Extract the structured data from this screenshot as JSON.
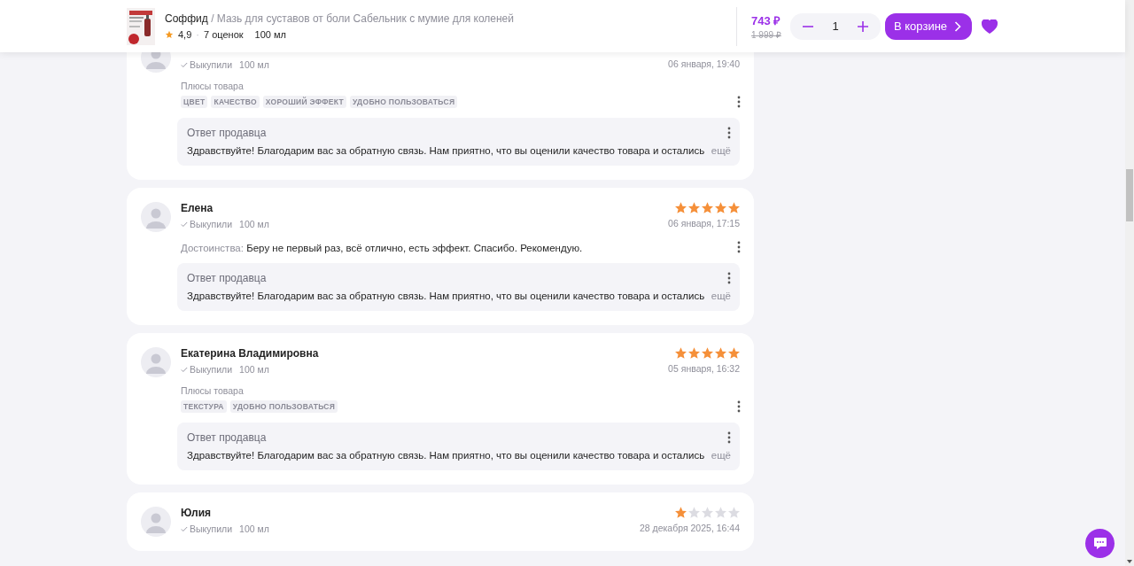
{
  "header": {
    "brand": "Соффид",
    "title": "/ Мазь для суставов от боли Сабельник с мумие для коленей",
    "rating": "4,9",
    "separator": "·",
    "reviews_count": "7 оценок",
    "volume": "100 мл",
    "price": "743 ₽",
    "old_price": "1 999 ₽",
    "quantity": "1",
    "cart_button": "В корзине",
    "favorite": true
  },
  "reviews": [
    {
      "purchased": "Выкупили",
      "volume": "100 мл",
      "date": "06 января, 19:40",
      "pros": {
        "label": "Плюсы товара",
        "tags": [
          "ЦВЕТ",
          "КАЧЕСТВО",
          "ХОРОШИЙ ЭФФЕКТ",
          "УДОБНО ПОЛЬЗОВАТЬСЯ"
        ]
      },
      "reply": {
        "title": "Ответ продавца",
        "text": "Здравствуйте! Благодарим вас за обратную связь. Нам приятно, что вы оценили качество товара и остались",
        "more": "ещё"
      }
    },
    {
      "name": "Елена",
      "stars": 5,
      "purchased": "Выкупили",
      "volume": "100 мл",
      "date": "06 января, 17:15",
      "pros": {
        "label": "Достоинства:",
        "text": "Беру не первый раз, всё отлично, есть эффект. Спасибо. Рекомендую."
      },
      "reply": {
        "title": "Ответ продавца",
        "text": "Здравствуйте! Благодарим вас за обратную связь. Нам приятно, что вы оценили качество товара и остались",
        "more": "ещё"
      }
    },
    {
      "name": "Екатерина Владимировна",
      "stars": 5,
      "purchased": "Выкупили",
      "volume": "100 мл",
      "date": "05 января, 16:32",
      "pros": {
        "label": "Плюсы товара",
        "tags": [
          "ТЕКСТУРА",
          "УДОБНО ПОЛЬЗОВАТЬСЯ"
        ]
      },
      "reply": {
        "title": "Ответ продавца",
        "text": "Здравствуйте! Благодарим вас за обратную связь. Нам приятно, что вы оценили качество товара и остались",
        "more": "ещё"
      }
    },
    {
      "name": "Юлия",
      "stars": 1,
      "purchased": "Выкупили",
      "volume": "100 мл",
      "date": "28 декабря 2025, 16:44"
    }
  ]
}
